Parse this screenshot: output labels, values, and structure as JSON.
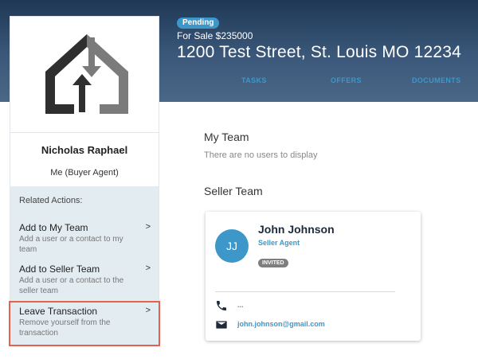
{
  "header": {
    "status": "Pending",
    "sale_line": "For Sale $235000",
    "address": "1200 Test Street, St. Louis MO 12234",
    "tabs": [
      "TASKS",
      "OFFERS",
      "DOCUMENTS"
    ]
  },
  "sidebar": {
    "name": "Nicholas Raphael",
    "role": "Me (Buyer Agent)",
    "related_actions_title": "Related Actions:",
    "actions": [
      {
        "title": "Add to My Team",
        "desc": "Add a user or a contact to my team",
        "chevron": ">"
      },
      {
        "title": "Add to Seller Team",
        "desc": "Add a user or a contact to the seller team",
        "chevron": ">"
      },
      {
        "title": "Leave Transaction",
        "desc": "Remove yourself from the transaction",
        "chevron": ">"
      }
    ]
  },
  "main": {
    "my_team_title": "My Team",
    "my_team_empty": "There are no users to display",
    "seller_team_title": "Seller Team",
    "contact": {
      "initials": "JJ",
      "name": "John Johnson",
      "role": "Seller Agent",
      "badge": "INVITED",
      "phone": "...",
      "email": "john.johnson@gmail.com"
    }
  },
  "icons": {
    "logo": "house-arrows-logo",
    "phone": "phone-icon",
    "email": "email-icon"
  },
  "colors": {
    "header": "#2f4b6c",
    "accent": "#3d97c8",
    "highlight": "#e2624e",
    "actions_bg": "#e3ecf0",
    "invited_badge": "#7e7e7e"
  }
}
